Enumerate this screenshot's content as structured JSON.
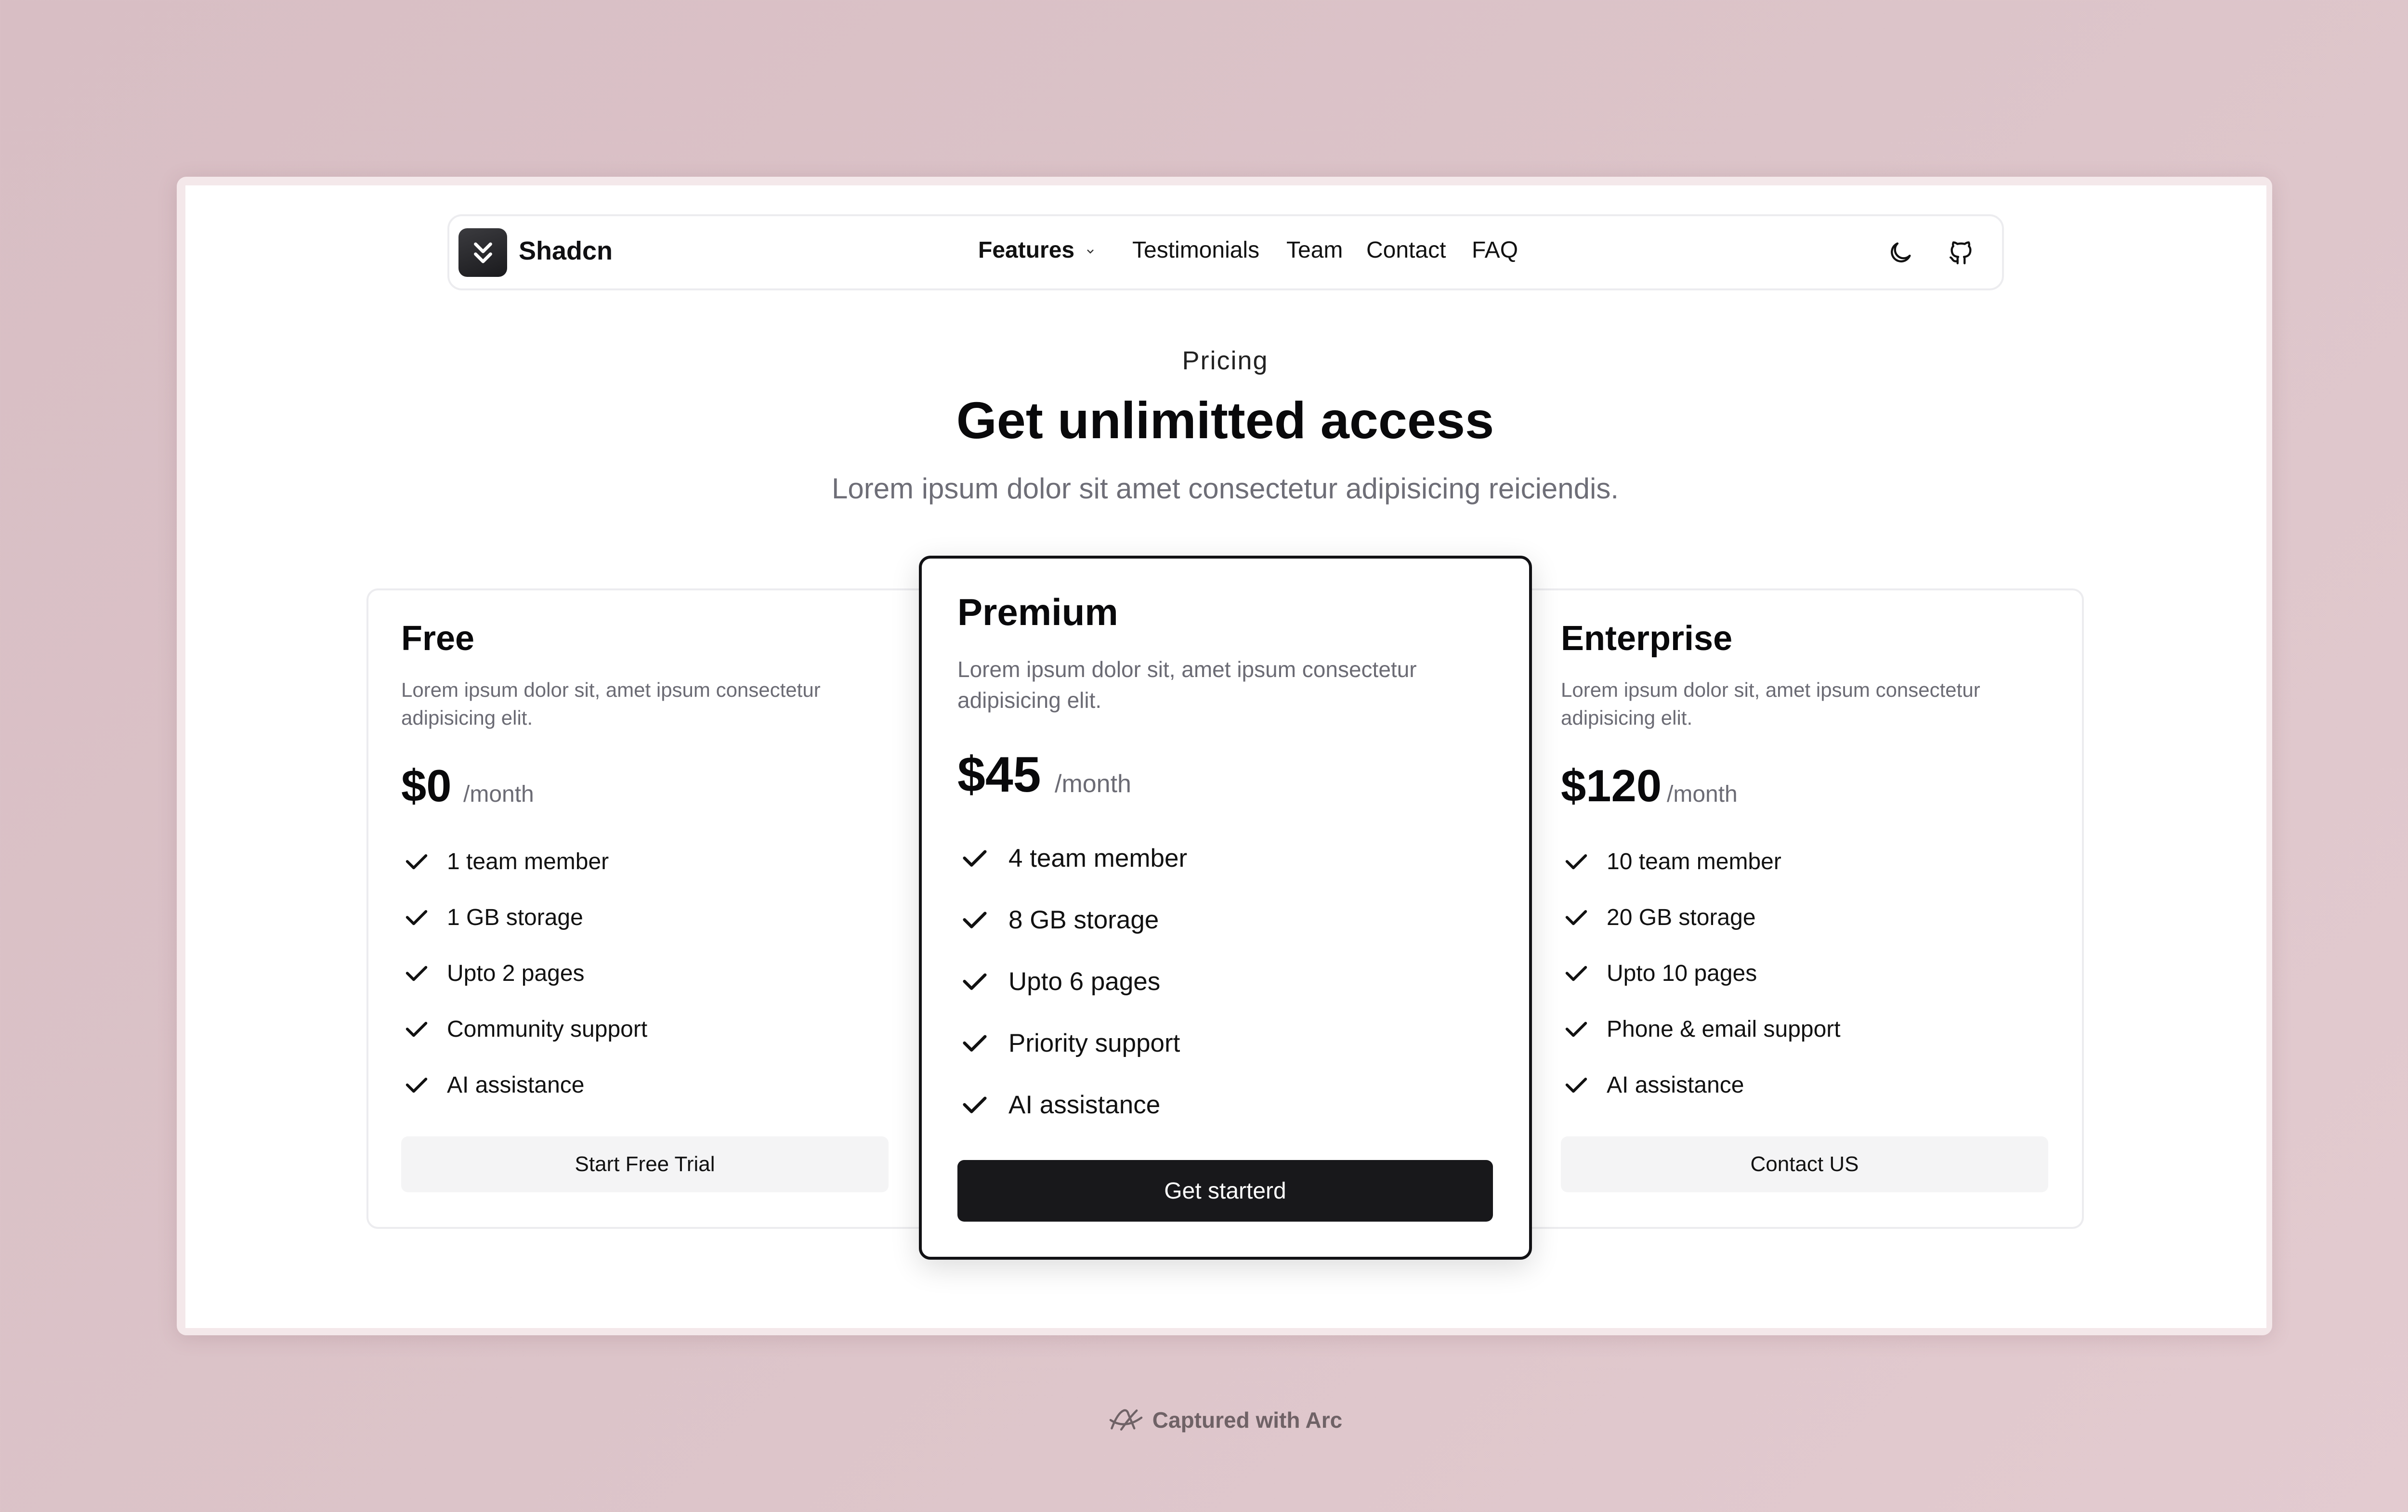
{
  "nav": {
    "brand": "Shadcn",
    "links": [
      "Features",
      "Testimonials",
      "Team",
      "Contact",
      "FAQ"
    ]
  },
  "hero": {
    "eyebrow": "Pricing",
    "title": "Get unlimitted access",
    "subtitle": "Lorem ipsum dolor sit amet consectetur adipisicing reiciendis."
  },
  "plans": [
    {
      "name": "Free",
      "desc_line1": "Lorem ipsum dolor sit, amet ipsum consectetur",
      "desc_line2": "adipisicing elit.",
      "price": "$0",
      "period": "/month",
      "features": [
        "1 team member",
        "1 GB storage",
        "Upto 2 pages",
        "Community support",
        "AI assistance"
      ],
      "cta": "Start Free Trial"
    },
    {
      "name": "Premium",
      "desc_line1": "Lorem ipsum dolor sit, amet ipsum consectetur",
      "desc_line2": "adipisicing elit.",
      "price": "$45",
      "period": "/month",
      "features": [
        "4 team member",
        "8 GB storage",
        "Upto 6 pages",
        "Priority support",
        "AI assistance"
      ],
      "cta": "Get starterd"
    },
    {
      "name": "Enterprise",
      "desc_line1": "Lorem ipsum dolor sit, amet ipsum consectetur",
      "desc_line2": "adipisicing elit.",
      "price": "$120",
      "period": "/month",
      "features": [
        "10 team member",
        "20 GB storage",
        "Upto 10 pages",
        "Phone & email support",
        "AI assistance"
      ],
      "cta": "Contact US"
    }
  ],
  "footer": {
    "caption": "Captured with Arc"
  },
  "icons": {
    "logo": "chevrons-down-icon",
    "theme": "moon-icon",
    "repo": "github-icon",
    "check": "check-icon",
    "arc": "arc-icon"
  },
  "colors": {
    "accent": "#18181b",
    "muted_text": "#6b6b74",
    "background": "#d8bec4"
  }
}
